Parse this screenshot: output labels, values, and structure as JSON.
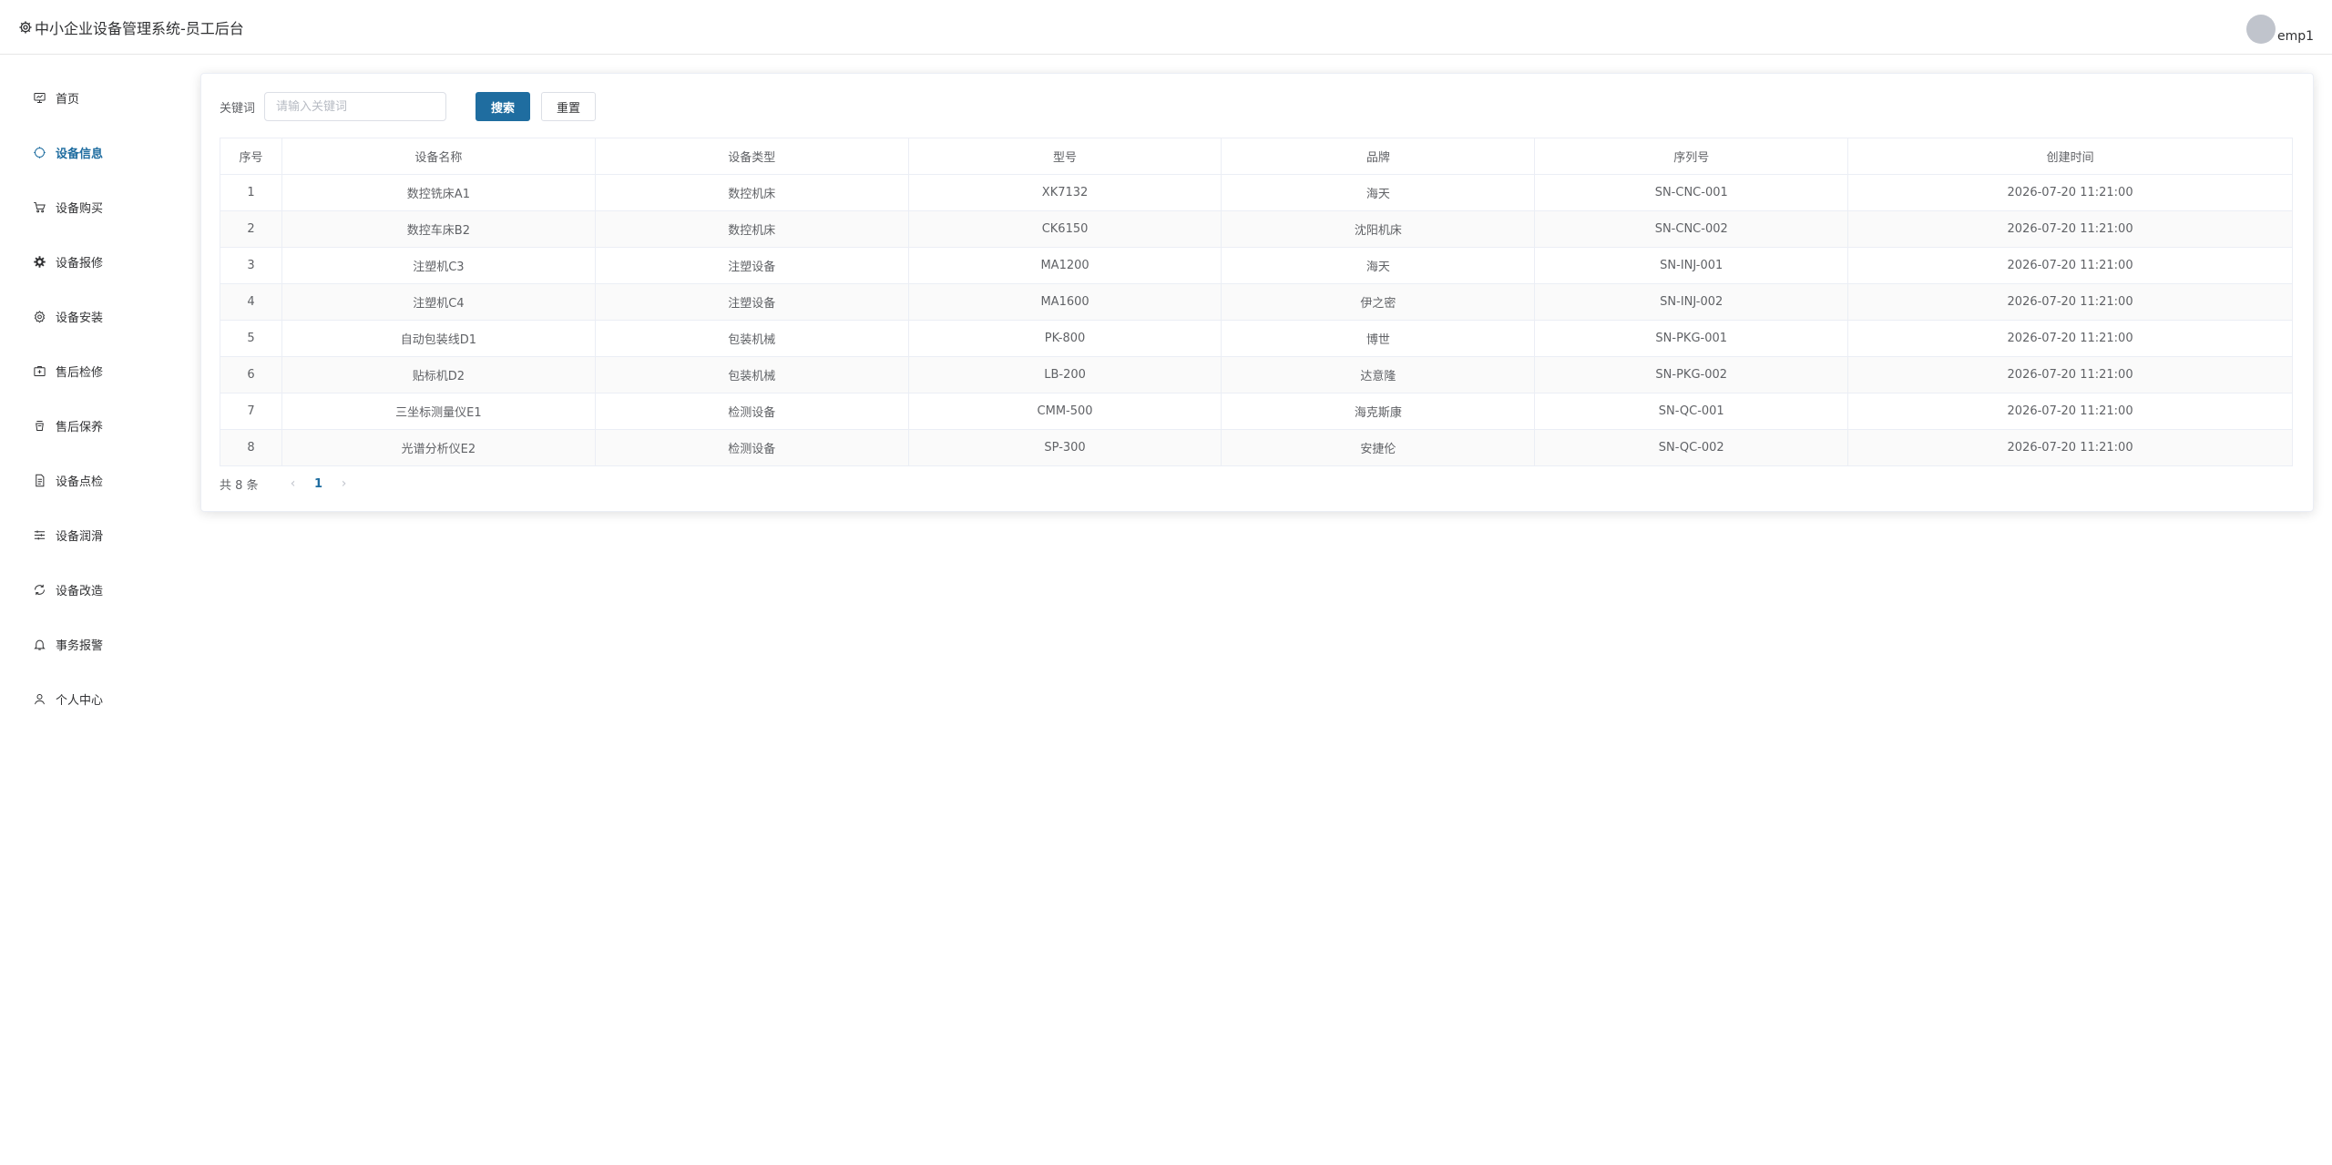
{
  "header": {
    "title": "中小企业设备管理系统-员工后台",
    "username": "emp1"
  },
  "sidebar": {
    "items": [
      {
        "label": "首页",
        "icon": "dashboard-icon",
        "active": false
      },
      {
        "label": "设备信息",
        "icon": "device-icon",
        "active": true
      },
      {
        "label": "设备购买",
        "icon": "cart-icon",
        "active": false
      },
      {
        "label": "设备报修",
        "icon": "gear-icon",
        "active": false
      },
      {
        "label": "设备安装",
        "icon": "setting-icon",
        "active": false
      },
      {
        "label": "售后检修",
        "icon": "briefcase-icon",
        "active": false
      },
      {
        "label": "售后保养",
        "icon": "cup-icon",
        "active": false
      },
      {
        "label": "设备点检",
        "icon": "document-icon",
        "active": false
      },
      {
        "label": "设备润滑",
        "icon": "sliders-icon",
        "active": false
      },
      {
        "label": "设备改造",
        "icon": "refresh-icon",
        "active": false
      },
      {
        "label": "事务报警",
        "icon": "bell-icon",
        "active": false
      },
      {
        "label": "个人中心",
        "icon": "user-icon",
        "active": false
      }
    ]
  },
  "search": {
    "label": "关键词",
    "placeholder": "请输入关键词",
    "search_button": "搜索",
    "reset_button": "重置"
  },
  "table": {
    "columns": [
      "序号",
      "设备名称",
      "设备类型",
      "型号",
      "品牌",
      "序列号",
      "创建时间"
    ],
    "rows": [
      [
        "1",
        "数控铣床A1",
        "数控机床",
        "XK7132",
        "海天",
        "SN-CNC-001",
        "2026-07-20 11:21:00"
      ],
      [
        "2",
        "数控车床B2",
        "数控机床",
        "CK6150",
        "沈阳机床",
        "SN-CNC-002",
        "2026-07-20 11:21:00"
      ],
      [
        "3",
        "注塑机C3",
        "注塑设备",
        "MA1200",
        "海天",
        "SN-INJ-001",
        "2026-07-20 11:21:00"
      ],
      [
        "4",
        "注塑机C4",
        "注塑设备",
        "MA1600",
        "伊之密",
        "SN-INJ-002",
        "2026-07-20 11:21:00"
      ],
      [
        "5",
        "自动包装线D1",
        "包装机械",
        "PK-800",
        "博世",
        "SN-PKG-001",
        "2026-07-20 11:21:00"
      ],
      [
        "6",
        "贴标机D2",
        "包装机械",
        "LB-200",
        "达意隆",
        "SN-PKG-002",
        "2026-07-20 11:21:00"
      ],
      [
        "7",
        "三坐标测量仪E1",
        "检测设备",
        "CMM-500",
        "海克斯康",
        "SN-QC-001",
        "2026-07-20 11:21:00"
      ],
      [
        "8",
        "光谱分析仪E2",
        "检测设备",
        "SP-300",
        "安捷伦",
        "SN-QC-002",
        "2026-07-20 11:21:00"
      ]
    ]
  },
  "pagination": {
    "total_text": "共 8 条",
    "current_page": "1",
    "prev": "‹",
    "next": "›"
  },
  "colors": {
    "accent": "#1f6da0"
  }
}
